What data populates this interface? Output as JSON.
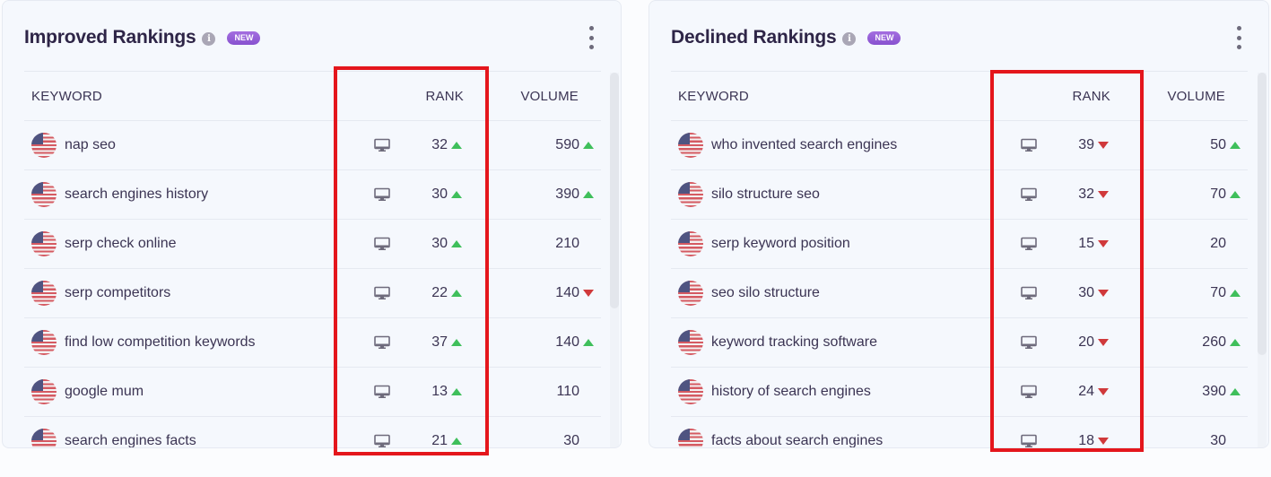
{
  "panels": [
    {
      "title": "Improved Rankings",
      "info_icon": "info-icon",
      "badge": "NEW",
      "menu_icon": "more-vertical-icon",
      "columns": {
        "keyword": "KEYWORD",
        "rank": "RANK",
        "volume": "VOLUME"
      },
      "rows": [
        {
          "keyword": "nap seo",
          "device": "desktop-icon",
          "rank": "32",
          "rank_trend": "up",
          "volume": "590",
          "volume_trend": "up"
        },
        {
          "keyword": "search engines history",
          "device": "desktop-icon",
          "rank": "30",
          "rank_trend": "up",
          "volume": "390",
          "volume_trend": "up"
        },
        {
          "keyword": "serp check online",
          "device": "desktop-icon",
          "rank": "30",
          "rank_trend": "up",
          "volume": "210",
          "volume_trend": "none"
        },
        {
          "keyword": "serp competitors",
          "device": "desktop-icon",
          "rank": "22",
          "rank_trend": "up",
          "volume": "140",
          "volume_trend": "down"
        },
        {
          "keyword": "find low competition keywords",
          "device": "desktop-icon",
          "rank": "37",
          "rank_trend": "up",
          "volume": "140",
          "volume_trend": "up"
        },
        {
          "keyword": "google mum",
          "device": "desktop-icon",
          "rank": "13",
          "rank_trend": "up",
          "volume": "110",
          "volume_trend": "none"
        },
        {
          "keyword": "search engines facts",
          "device": "desktop-icon",
          "rank": "21",
          "rank_trend": "up",
          "volume": "30",
          "volume_trend": "none"
        }
      ]
    },
    {
      "title": "Declined Rankings",
      "info_icon": "info-icon",
      "badge": "NEW",
      "menu_icon": "more-vertical-icon",
      "columns": {
        "keyword": "KEYWORD",
        "rank": "RANK",
        "volume": "VOLUME"
      },
      "rows": [
        {
          "keyword": "who invented search engines",
          "device": "desktop-icon",
          "rank": "39",
          "rank_trend": "down",
          "volume": "50",
          "volume_trend": "up"
        },
        {
          "keyword": "silo structure seo",
          "device": "desktop-icon",
          "rank": "32",
          "rank_trend": "down",
          "volume": "70",
          "volume_trend": "up"
        },
        {
          "keyword": "serp keyword position",
          "device": "desktop-icon",
          "rank": "15",
          "rank_trend": "down",
          "volume": "20",
          "volume_trend": "none"
        },
        {
          "keyword": "seo silo structure",
          "device": "desktop-icon",
          "rank": "30",
          "rank_trend": "down",
          "volume": "70",
          "volume_trend": "up"
        },
        {
          "keyword": "keyword tracking software",
          "device": "desktop-icon",
          "rank": "20",
          "rank_trend": "down",
          "volume": "260",
          "volume_trend": "up"
        },
        {
          "keyword": "history of search engines",
          "device": "desktop-icon",
          "rank": "24",
          "rank_trend": "down",
          "volume": "390",
          "volume_trend": "up"
        },
        {
          "keyword": "facts about search engines",
          "device": "desktop-icon",
          "rank": "18",
          "rank_trend": "down",
          "volume": "30",
          "volume_trend": "none"
        }
      ]
    }
  ],
  "colors": {
    "up": "#3fbf5b",
    "down": "#d0393b",
    "badge": "#9a62db",
    "highlight": "#e4161c"
  }
}
